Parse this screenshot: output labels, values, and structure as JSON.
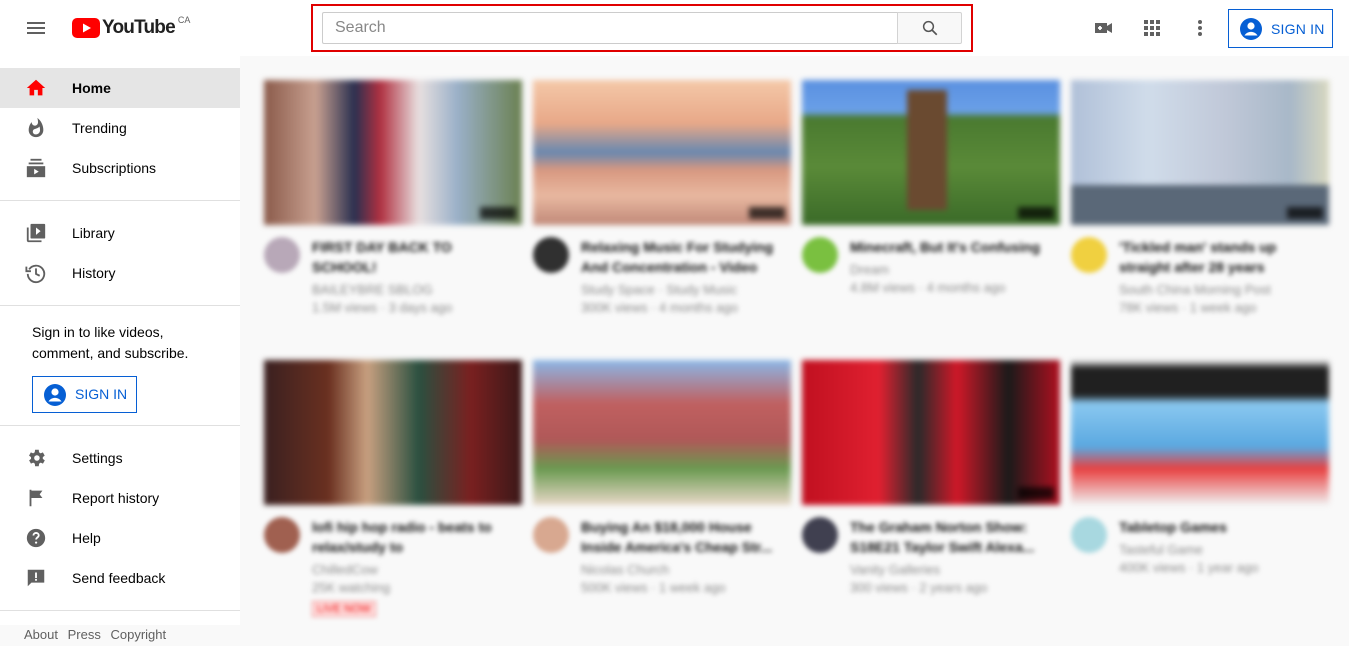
{
  "header": {
    "logo_text": "YouTube",
    "logo_country": "CA",
    "search_placeholder": "Search",
    "search_value": "",
    "sign_in_label": "SIGN IN"
  },
  "sidebar": {
    "items": [
      {
        "label": "Home",
        "icon": "home-icon",
        "active": true
      },
      {
        "label": "Trending",
        "icon": "trending-icon"
      },
      {
        "label": "Subscriptions",
        "icon": "subscriptions-icon"
      },
      {
        "label": "Library",
        "icon": "library-icon"
      },
      {
        "label": "History",
        "icon": "history-icon"
      },
      {
        "label": "Settings",
        "icon": "gear-icon"
      },
      {
        "label": "Report history",
        "icon": "flag-icon"
      },
      {
        "label": "Help",
        "icon": "help-icon"
      },
      {
        "label": "Send feedback",
        "icon": "feedback-icon"
      }
    ],
    "promo_text": "Sign in to like videos, comment, and subscribe.",
    "sign_in_label": "SIGN IN",
    "footer_links": [
      "About",
      "Press",
      "Copyright"
    ]
  },
  "videos": [
    {
      "title": "FIRST DAY BACK TO SCHOOL!",
      "channel": "BAILEYBRE SBLOG",
      "stats": "1.5M views · 3 days ago"
    },
    {
      "title": "Relaxing Music For Studying And Concentration - Video",
      "channel": "Study Space · Study Music",
      "stats": "300K views · 4 months ago"
    },
    {
      "title": "Minecraft, But It's Confusing",
      "channel": "Dream",
      "stats": "4.8M views · 4 months ago"
    },
    {
      "title": "'Tickled man' stands up straight after 28 years",
      "channel": "South China Morning Post",
      "stats": "78K views · 1 week ago"
    },
    {
      "title": "lofi hip hop radio - beats to relax/study to",
      "channel": "ChilledCow",
      "stats": "25K watching",
      "badge": "LIVE NOW"
    },
    {
      "title": "Buying An $18,000 House Inside America's Cheap Str...",
      "channel": "Nicolas Church",
      "stats": "500K views · 1 week ago"
    },
    {
      "title": "The Graham Norton Show: S18E21 Taylor Swift Alexa...",
      "channel": "Vanity Galleries",
      "stats": "300 views · 2 years ago"
    },
    {
      "title": "Tabletop Games",
      "channel": "Tasteful Game",
      "stats": "400K views · 1 year ago"
    }
  ]
}
